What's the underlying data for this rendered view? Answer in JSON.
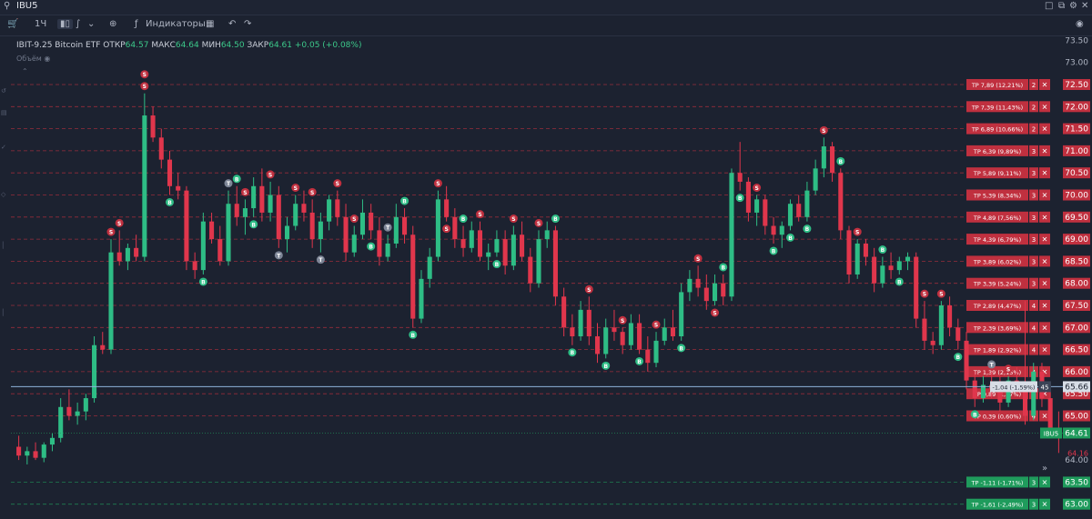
{
  "window": {
    "symbol": "IBU5",
    "icons": [
      "search-icon",
      "maximize-icon",
      "popout-icon",
      "settings-icon",
      "close-icon"
    ]
  },
  "toolbar": {
    "timeframe": "1Ч",
    "indicators_label": "Индикаторы",
    "icons": [
      "cart-icon",
      "candles-icon",
      "bars-icon",
      "chevron-down-icon",
      "add-circle-icon",
      "indicators-icon",
      "layouts-icon",
      "undo-icon",
      "redo-icon",
      "camera-icon"
    ]
  },
  "legend": {
    "name": "IBIT-9.25 Bitcoin ETF",
    "open_label": "ОТКР",
    "open": "64.57",
    "high_label": "МАКС",
    "high": "64.64",
    "low_label": "МИН",
    "low": "64.50",
    "close_label": "ЗАКР",
    "close": "64.61",
    "change": "+0.05 (+0.08%)",
    "volume_label": "Объём"
  },
  "chart_data": {
    "type": "candlestick",
    "y_axis_side": "right",
    "ylim": [
      63.0,
      73.5
    ],
    "y_ticks": [
      "73.50",
      "73.00",
      "72.50",
      "72.00",
      "71.50",
      "71.00",
      "70.50",
      "70.00",
      "69.50",
      "69.00",
      "68.50",
      "68.00",
      "67.50",
      "67.00",
      "66.50",
      "66.00",
      "65.50",
      "65.00",
      "64.00",
      "63.50",
      "63.00"
    ],
    "colors": {
      "up": "#2ebd85",
      "down": "#e0364c",
      "take_profit_up": "#c0303f",
      "take_profit_down": "#1f9b5c",
      "grid": "#2b3345"
    },
    "last_price": {
      "symbol": "IBU5",
      "value": "64.61",
      "color": "#1f9b5c"
    },
    "low_marker": "64.16",
    "position_line": {
      "price": 65.66,
      "label": "-1,04 (-1,59%)",
      "qty": "45"
    },
    "take_profit_orders": [
      {
        "price": 72.5,
        "label": "TP 7,89 (12,21%)",
        "qty": "2",
        "side": "above"
      },
      {
        "price": 72.0,
        "label": "TP 7,39 (11,43%)",
        "qty": "2",
        "side": "above"
      },
      {
        "price": 71.5,
        "label": "TP 6,89 (10,66%)",
        "qty": "2",
        "side": "above"
      },
      {
        "price": 71.0,
        "label": "TP 6,39 (9,89%)",
        "qty": "3",
        "side": "above"
      },
      {
        "price": 70.5,
        "label": "TP 5,89 (9,11%)",
        "qty": "3",
        "side": "above"
      },
      {
        "price": 70.0,
        "label": "TP 5,39 (8,34%)",
        "qty": "3",
        "side": "above"
      },
      {
        "price": 69.5,
        "label": "TP 4,89 (7,56%)",
        "qty": "3",
        "side": "above"
      },
      {
        "price": 69.0,
        "label": "TP 4,39 (6,79%)",
        "qty": "3",
        "side": "above"
      },
      {
        "price": 68.5,
        "label": "TP 3,89 (6,02%)",
        "qty": "3",
        "side": "above"
      },
      {
        "price": 68.0,
        "label": "TP 3,39 (5,24%)",
        "qty": "3",
        "side": "above"
      },
      {
        "price": 67.5,
        "label": "TP 2,89 (4,47%)",
        "qty": "4",
        "side": "above"
      },
      {
        "price": 67.0,
        "label": "TP 2,39 (3,69%)",
        "qty": "4",
        "side": "above"
      },
      {
        "price": 66.5,
        "label": "TP 1,89 (2,92%)",
        "qty": "4",
        "side": "above"
      },
      {
        "price": 66.0,
        "label": "TP 1,39 (2,15%)",
        "qty": "4",
        "side": "above"
      },
      {
        "price": 65.5,
        "label": "TP 0,89 (1,37%)",
        "qty": "4",
        "side": "above"
      },
      {
        "price": 65.0,
        "label": "TP 0,39 (0,60%)",
        "qty": "4",
        "side": "above"
      },
      {
        "price": 63.5,
        "label": "TP -1,11 (-1,71%)",
        "qty": "3",
        "side": "below"
      },
      {
        "price": 63.0,
        "label": "TP -1,61 (-2,49%)",
        "qty": "3",
        "side": "below"
      }
    ],
    "candles": [
      {
        "o": 64.3,
        "h": 64.55,
        "l": 64.0,
        "c": 64.1
      },
      {
        "o": 64.1,
        "h": 64.3,
        "l": 63.9,
        "c": 64.2
      },
      {
        "o": 64.2,
        "h": 64.4,
        "l": 64.0,
        "c": 64.05
      },
      {
        "o": 64.05,
        "h": 64.4,
        "l": 63.95,
        "c": 64.35
      },
      {
        "o": 64.35,
        "h": 64.6,
        "l": 64.2,
        "c": 64.5
      },
      {
        "o": 64.5,
        "h": 65.4,
        "l": 64.4,
        "c": 65.2
      },
      {
        "o": 65.2,
        "h": 65.6,
        "l": 64.9,
        "c": 65.0
      },
      {
        "o": 65.0,
        "h": 65.3,
        "l": 64.8,
        "c": 65.1
      },
      {
        "o": 65.1,
        "h": 65.5,
        "l": 64.9,
        "c": 65.4
      },
      {
        "o": 65.4,
        "h": 66.8,
        "l": 65.3,
        "c": 66.6
      },
      {
        "o": 66.6,
        "h": 66.9,
        "l": 66.4,
        "c": 66.5
      },
      {
        "o": 66.5,
        "h": 69.0,
        "l": 66.4,
        "c": 68.7
      },
      {
        "o": 68.7,
        "h": 69.2,
        "l": 68.4,
        "c": 68.5
      },
      {
        "o": 68.5,
        "h": 68.9,
        "l": 68.3,
        "c": 68.8
      },
      {
        "o": 68.8,
        "h": 69.1,
        "l": 68.5,
        "c": 68.6
      },
      {
        "o": 68.6,
        "h": 72.3,
        "l": 68.5,
        "c": 71.8
      },
      {
        "o": 71.8,
        "h": 72.0,
        "l": 71.2,
        "c": 71.3
      },
      {
        "o": 71.3,
        "h": 71.5,
        "l": 70.6,
        "c": 70.8
      },
      {
        "o": 70.8,
        "h": 71.0,
        "l": 70.0,
        "c": 70.2
      },
      {
        "o": 70.2,
        "h": 70.5,
        "l": 69.9,
        "c": 70.1
      },
      {
        "o": 70.1,
        "h": 70.2,
        "l": 68.3,
        "c": 68.5
      },
      {
        "o": 68.5,
        "h": 68.7,
        "l": 68.1,
        "c": 68.3
      },
      {
        "o": 68.3,
        "h": 69.6,
        "l": 68.2,
        "c": 69.4
      },
      {
        "o": 69.4,
        "h": 69.6,
        "l": 68.9,
        "c": 69.0
      },
      {
        "o": 69.0,
        "h": 69.3,
        "l": 68.4,
        "c": 68.5
      },
      {
        "o": 68.5,
        "h": 70.1,
        "l": 68.4,
        "c": 69.8
      },
      {
        "o": 69.8,
        "h": 70.2,
        "l": 69.3,
        "c": 69.5
      },
      {
        "o": 69.5,
        "h": 69.9,
        "l": 69.1,
        "c": 69.7
      },
      {
        "o": 69.7,
        "h": 70.4,
        "l": 69.5,
        "c": 70.2
      },
      {
        "o": 70.2,
        "h": 70.6,
        "l": 69.4,
        "c": 69.6
      },
      {
        "o": 69.6,
        "h": 70.3,
        "l": 69.4,
        "c": 70.0
      },
      {
        "o": 70.0,
        "h": 70.2,
        "l": 68.8,
        "c": 69.0
      },
      {
        "o": 69.0,
        "h": 69.5,
        "l": 68.7,
        "c": 69.3
      },
      {
        "o": 69.3,
        "h": 70.0,
        "l": 69.2,
        "c": 69.8
      },
      {
        "o": 69.8,
        "h": 70.1,
        "l": 69.4,
        "c": 69.6
      },
      {
        "o": 69.6,
        "h": 69.9,
        "l": 68.8,
        "c": 69.0
      },
      {
        "o": 69.0,
        "h": 69.6,
        "l": 68.7,
        "c": 69.4
      },
      {
        "o": 69.4,
        "h": 70.0,
        "l": 69.2,
        "c": 69.9
      },
      {
        "o": 69.9,
        "h": 70.1,
        "l": 69.3,
        "c": 69.5
      },
      {
        "o": 69.5,
        "h": 69.8,
        "l": 68.5,
        "c": 68.7
      },
      {
        "o": 68.7,
        "h": 69.3,
        "l": 68.6,
        "c": 69.1
      },
      {
        "o": 69.1,
        "h": 69.9,
        "l": 69.0,
        "c": 69.6
      },
      {
        "o": 69.6,
        "h": 69.8,
        "l": 69.0,
        "c": 69.2
      },
      {
        "o": 69.2,
        "h": 69.5,
        "l": 68.4,
        "c": 68.6
      },
      {
        "o": 68.6,
        "h": 69.1,
        "l": 68.5,
        "c": 68.9
      },
      {
        "o": 68.9,
        "h": 69.8,
        "l": 68.8,
        "c": 69.5
      },
      {
        "o": 69.5,
        "h": 69.7,
        "l": 68.9,
        "c": 69.1
      },
      {
        "o": 69.1,
        "h": 69.3,
        "l": 67.0,
        "c": 67.2
      },
      {
        "o": 67.2,
        "h": 68.3,
        "l": 67.1,
        "c": 68.1
      },
      {
        "o": 68.1,
        "h": 68.8,
        "l": 67.9,
        "c": 68.6
      },
      {
        "o": 68.6,
        "h": 70.1,
        "l": 68.5,
        "c": 69.9
      },
      {
        "o": 69.9,
        "h": 70.2,
        "l": 69.4,
        "c": 69.5
      },
      {
        "o": 69.5,
        "h": 69.7,
        "l": 68.8,
        "c": 69.0
      },
      {
        "o": 69.0,
        "h": 69.3,
        "l": 68.6,
        "c": 68.8
      },
      {
        "o": 68.8,
        "h": 69.4,
        "l": 68.7,
        "c": 69.2
      },
      {
        "o": 69.2,
        "h": 69.4,
        "l": 68.5,
        "c": 68.6
      },
      {
        "o": 68.6,
        "h": 68.9,
        "l": 68.3,
        "c": 68.7
      },
      {
        "o": 68.7,
        "h": 69.2,
        "l": 68.6,
        "c": 69.0
      },
      {
        "o": 69.0,
        "h": 69.2,
        "l": 68.2,
        "c": 68.4
      },
      {
        "o": 68.4,
        "h": 69.3,
        "l": 68.3,
        "c": 69.1
      },
      {
        "o": 69.1,
        "h": 69.4,
        "l": 68.5,
        "c": 68.6
      },
      {
        "o": 68.6,
        "h": 68.8,
        "l": 67.8,
        "c": 68.0
      },
      {
        "o": 68.0,
        "h": 69.2,
        "l": 67.9,
        "c": 69.0
      },
      {
        "o": 69.0,
        "h": 69.4,
        "l": 68.8,
        "c": 69.2
      },
      {
        "o": 69.2,
        "h": 69.3,
        "l": 67.5,
        "c": 67.7
      },
      {
        "o": 67.7,
        "h": 67.9,
        "l": 66.8,
        "c": 67.0
      },
      {
        "o": 67.0,
        "h": 67.3,
        "l": 66.6,
        "c": 66.8
      },
      {
        "o": 66.8,
        "h": 67.6,
        "l": 66.7,
        "c": 67.4
      },
      {
        "o": 67.4,
        "h": 67.7,
        "l": 66.6,
        "c": 66.8
      },
      {
        "o": 66.8,
        "h": 67.1,
        "l": 66.2,
        "c": 66.4
      },
      {
        "o": 66.4,
        "h": 67.2,
        "l": 66.3,
        "c": 67.0
      },
      {
        "o": 67.0,
        "h": 67.4,
        "l": 66.7,
        "c": 66.9
      },
      {
        "o": 66.9,
        "h": 67.0,
        "l": 66.4,
        "c": 66.6
      },
      {
        "o": 66.6,
        "h": 67.3,
        "l": 66.5,
        "c": 67.1
      },
      {
        "o": 67.1,
        "h": 67.3,
        "l": 66.4,
        "c": 66.5
      },
      {
        "o": 66.5,
        "h": 66.8,
        "l": 66.0,
        "c": 66.2
      },
      {
        "o": 66.2,
        "h": 66.9,
        "l": 66.1,
        "c": 66.7
      },
      {
        "o": 66.7,
        "h": 67.2,
        "l": 66.6,
        "c": 67.0
      },
      {
        "o": 67.0,
        "h": 67.4,
        "l": 66.7,
        "c": 66.8
      },
      {
        "o": 66.8,
        "h": 68.0,
        "l": 66.7,
        "c": 67.8
      },
      {
        "o": 67.8,
        "h": 68.3,
        "l": 67.6,
        "c": 68.1
      },
      {
        "o": 68.1,
        "h": 68.4,
        "l": 67.7,
        "c": 67.9
      },
      {
        "o": 67.9,
        "h": 68.2,
        "l": 67.4,
        "c": 67.6
      },
      {
        "o": 67.6,
        "h": 68.2,
        "l": 67.5,
        "c": 68.0
      },
      {
        "o": 68.0,
        "h": 68.2,
        "l": 67.5,
        "c": 67.7
      },
      {
        "o": 67.7,
        "h": 70.6,
        "l": 67.6,
        "c": 70.5
      },
      {
        "o": 70.5,
        "h": 71.2,
        "l": 70.1,
        "c": 70.3
      },
      {
        "o": 70.3,
        "h": 70.4,
        "l": 69.4,
        "c": 69.6
      },
      {
        "o": 69.6,
        "h": 70.0,
        "l": 69.3,
        "c": 69.9
      },
      {
        "o": 69.9,
        "h": 70.0,
        "l": 69.1,
        "c": 69.3
      },
      {
        "o": 69.3,
        "h": 69.5,
        "l": 68.9,
        "c": 69.1
      },
      {
        "o": 69.1,
        "h": 69.4,
        "l": 68.8,
        "c": 69.3
      },
      {
        "o": 69.3,
        "h": 69.9,
        "l": 69.2,
        "c": 69.8
      },
      {
        "o": 69.8,
        "h": 70.0,
        "l": 69.4,
        "c": 69.5
      },
      {
        "o": 69.5,
        "h": 70.3,
        "l": 69.4,
        "c": 70.1
      },
      {
        "o": 70.1,
        "h": 70.8,
        "l": 70.0,
        "c": 70.6
      },
      {
        "o": 70.6,
        "h": 71.3,
        "l": 70.4,
        "c": 71.1
      },
      {
        "o": 71.1,
        "h": 71.2,
        "l": 70.3,
        "c": 70.5
      },
      {
        "o": 70.5,
        "h": 70.6,
        "l": 69.0,
        "c": 69.2
      },
      {
        "o": 69.2,
        "h": 69.3,
        "l": 68.0,
        "c": 68.2
      },
      {
        "o": 68.2,
        "h": 69.0,
        "l": 68.1,
        "c": 68.9
      },
      {
        "o": 68.9,
        "h": 69.0,
        "l": 68.4,
        "c": 68.6
      },
      {
        "o": 68.6,
        "h": 68.8,
        "l": 67.8,
        "c": 68.0
      },
      {
        "o": 68.0,
        "h": 68.6,
        "l": 67.9,
        "c": 68.4
      },
      {
        "o": 68.4,
        "h": 68.7,
        "l": 68.1,
        "c": 68.3
      },
      {
        "o": 68.3,
        "h": 68.6,
        "l": 68.2,
        "c": 68.5
      },
      {
        "o": 68.5,
        "h": 68.7,
        "l": 68.3,
        "c": 68.6
      },
      {
        "o": 68.6,
        "h": 68.7,
        "l": 67.0,
        "c": 67.2
      },
      {
        "o": 67.2,
        "h": 67.6,
        "l": 66.5,
        "c": 66.7
      },
      {
        "o": 66.7,
        "h": 66.9,
        "l": 66.4,
        "c": 66.6
      },
      {
        "o": 66.6,
        "h": 67.6,
        "l": 66.5,
        "c": 67.5
      },
      {
        "o": 67.5,
        "h": 67.7,
        "l": 66.8,
        "c": 67.0
      },
      {
        "o": 67.0,
        "h": 67.2,
        "l": 66.5,
        "c": 66.7
      },
      {
        "o": 66.7,
        "h": 66.9,
        "l": 65.6,
        "c": 65.8
      },
      {
        "o": 65.8,
        "h": 66.0,
        "l": 65.2,
        "c": 65.4
      },
      {
        "o": 65.4,
        "h": 65.9,
        "l": 65.3,
        "c": 65.7
      },
      {
        "o": 65.7,
        "h": 66.0,
        "l": 65.4,
        "c": 65.6
      },
      {
        "o": 65.6,
        "h": 65.9,
        "l": 65.1,
        "c": 65.3
      },
      {
        "o": 65.3,
        "h": 65.9,
        "l": 65.2,
        "c": 65.8
      },
      {
        "o": 65.8,
        "h": 66.1,
        "l": 65.5,
        "c": 65.7
      },
      {
        "o": 65.7,
        "h": 67.6,
        "l": 64.8,
        "c": 65.0
      },
      {
        "o": 65.0,
        "h": 66.2,
        "l": 64.9,
        "c": 66.0
      },
      {
        "o": 66.0,
        "h": 66.2,
        "l": 65.2,
        "c": 65.4
      },
      {
        "o": 65.4,
        "h": 65.6,
        "l": 64.5,
        "c": 64.7
      },
      {
        "o": 64.7,
        "h": 65.1,
        "l": 64.16,
        "c": 64.61
      }
    ],
    "markers": [
      {
        "i": 11,
        "type": "S",
        "pos": "above"
      },
      {
        "i": 15,
        "type": "S",
        "pos": "above"
      },
      {
        "i": 15,
        "type": "S",
        "pos": "above",
        "stack": 1
      },
      {
        "i": 18,
        "type": "B",
        "pos": "below"
      },
      {
        "i": 12,
        "type": "S",
        "pos": "above"
      },
      {
        "i": 22,
        "type": "B",
        "pos": "below"
      },
      {
        "i": 25,
        "type": "T",
        "pos": "above"
      },
      {
        "i": 26,
        "type": "B",
        "pos": "above"
      },
      {
        "i": 27,
        "type": "S",
        "pos": "above"
      },
      {
        "i": 28,
        "type": "B",
        "pos": "below"
      },
      {
        "i": 30,
        "type": "S",
        "pos": "above"
      },
      {
        "i": 31,
        "type": "T",
        "pos": "below"
      },
      {
        "i": 33,
        "type": "S",
        "pos": "above"
      },
      {
        "i": 35,
        "type": "S",
        "pos": "above"
      },
      {
        "i": 36,
        "type": "T",
        "pos": "below"
      },
      {
        "i": 38,
        "type": "S",
        "pos": "above"
      },
      {
        "i": 40,
        "type": "S",
        "pos": "above"
      },
      {
        "i": 42,
        "type": "B",
        "pos": "below"
      },
      {
        "i": 44,
        "type": "T",
        "pos": "above"
      },
      {
        "i": 46,
        "type": "B",
        "pos": "above"
      },
      {
        "i": 47,
        "type": "B",
        "pos": "below"
      },
      {
        "i": 50,
        "type": "S",
        "pos": "above"
      },
      {
        "i": 51,
        "type": "S",
        "pos": "below"
      },
      {
        "i": 53,
        "type": "B",
        "pos": "above"
      },
      {
        "i": 55,
        "type": "S",
        "pos": "above"
      },
      {
        "i": 57,
        "type": "B",
        "pos": "below"
      },
      {
        "i": 59,
        "type": "S",
        "pos": "above"
      },
      {
        "i": 62,
        "type": "S",
        "pos": "above"
      },
      {
        "i": 64,
        "type": "B",
        "pos": "above"
      },
      {
        "i": 66,
        "type": "B",
        "pos": "below"
      },
      {
        "i": 68,
        "type": "S",
        "pos": "above"
      },
      {
        "i": 70,
        "type": "B",
        "pos": "below"
      },
      {
        "i": 72,
        "type": "S",
        "pos": "above"
      },
      {
        "i": 74,
        "type": "B",
        "pos": "below"
      },
      {
        "i": 76,
        "type": "S",
        "pos": "above"
      },
      {
        "i": 79,
        "type": "B",
        "pos": "below"
      },
      {
        "i": 81,
        "type": "S",
        "pos": "above"
      },
      {
        "i": 83,
        "type": "S",
        "pos": "below"
      },
      {
        "i": 84,
        "type": "B",
        "pos": "above"
      },
      {
        "i": 86,
        "type": "B",
        "pos": "below"
      },
      {
        "i": 88,
        "type": "S",
        "pos": "above"
      },
      {
        "i": 90,
        "type": "B",
        "pos": "below"
      },
      {
        "i": 92,
        "type": "B",
        "pos": "below"
      },
      {
        "i": 94,
        "type": "B",
        "pos": "below"
      },
      {
        "i": 96,
        "type": "S",
        "pos": "above"
      },
      {
        "i": 98,
        "type": "B",
        "pos": "above"
      },
      {
        "i": 100,
        "type": "S",
        "pos": "above"
      },
      {
        "i": 103,
        "type": "B",
        "pos": "above"
      },
      {
        "i": 105,
        "type": "B",
        "pos": "below"
      },
      {
        "i": 108,
        "type": "S",
        "pos": "above"
      },
      {
        "i": 110,
        "type": "S",
        "pos": "above"
      },
      {
        "i": 112,
        "type": "B",
        "pos": "below"
      },
      {
        "i": 114,
        "type": "B",
        "pos": "below"
      },
      {
        "i": 116,
        "type": "T",
        "pos": "above"
      },
      {
        "i": 118,
        "type": "S",
        "pos": "above"
      }
    ]
  }
}
